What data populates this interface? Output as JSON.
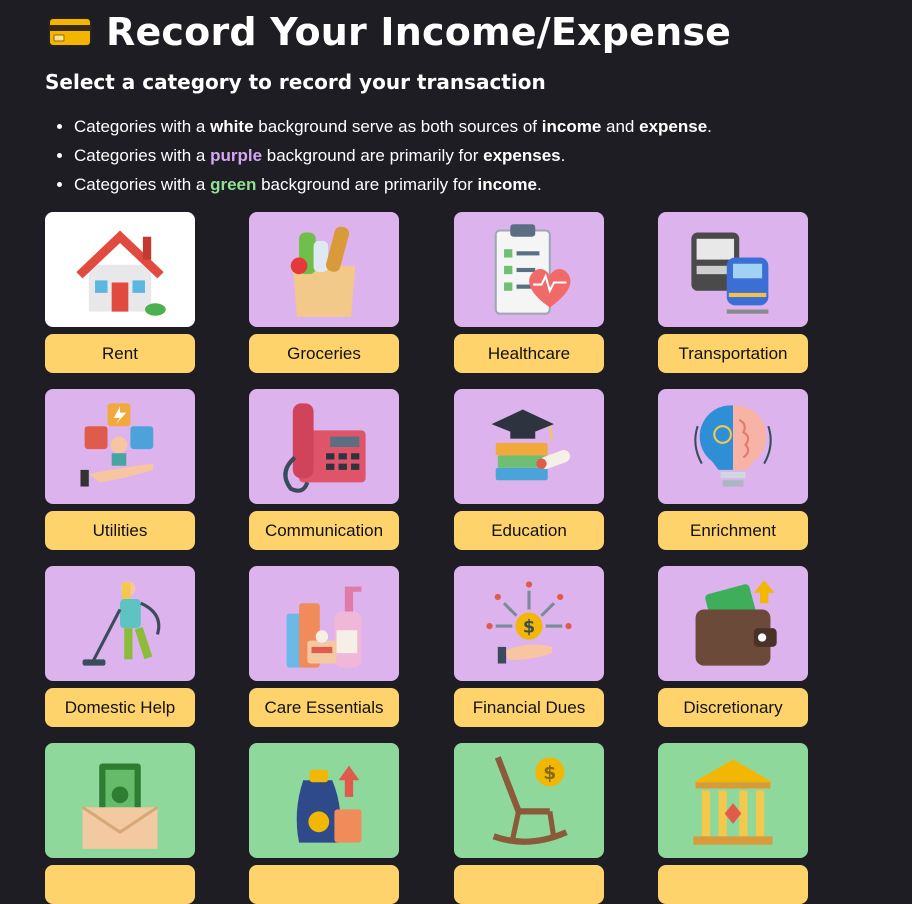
{
  "header": {
    "title": "Record Your Income/Expense",
    "subtitle": "Select a category to record your transaction"
  },
  "notes": [
    {
      "pre": "Categories with a ",
      "hl": "white",
      "mid": " background serve as both sources of ",
      "b1": "income",
      "and": " and ",
      "b2": "expense",
      "end": "."
    },
    {
      "pre": "Categories with a ",
      "hl": "purple",
      "mid": " background are primarily for ",
      "b1": "expenses",
      "end": "."
    },
    {
      "pre": "Categories with a ",
      "hl": "green",
      "mid": " background are primarily for ",
      "b1": "income",
      "end": "."
    }
  ],
  "categories": [
    {
      "label": "Rent",
      "bg": "white",
      "icon": "house-icon"
    },
    {
      "label": "Groceries",
      "bg": "purple",
      "icon": "grocery-bag-icon"
    },
    {
      "label": "Healthcare",
      "bg": "purple",
      "icon": "clipboard-heart-icon"
    },
    {
      "label": "Transportation",
      "bg": "purple",
      "icon": "bus-train-icon"
    },
    {
      "label": "Utilities",
      "bg": "purple",
      "icon": "utilities-hand-icon"
    },
    {
      "label": "Communication",
      "bg": "purple",
      "icon": "telephone-icon"
    },
    {
      "label": "Education",
      "bg": "purple",
      "icon": "books-graduation-cap-icon"
    },
    {
      "label": "Enrichment",
      "bg": "purple",
      "icon": "lightbulb-brain-icon"
    },
    {
      "label": "Domestic Help",
      "bg": "purple",
      "icon": "person-vacuum-icon"
    },
    {
      "label": "Care Essentials",
      "bg": "purple",
      "icon": "toiletries-icon"
    },
    {
      "label": "Financial Dues",
      "bg": "purple",
      "icon": "hand-coin-arrows-icon"
    },
    {
      "label": "Discretionary",
      "bg": "purple",
      "icon": "wallet-icon"
    },
    {
      "label": "",
      "bg": "green",
      "icon": "money-envelope-icon"
    },
    {
      "label": "",
      "bg": "green",
      "icon": "money-bag-growth-icon"
    },
    {
      "label": "",
      "bg": "green",
      "icon": "rocking-chair-coin-icon"
    },
    {
      "label": "",
      "bg": "green",
      "icon": "bank-building-icon"
    }
  ]
}
